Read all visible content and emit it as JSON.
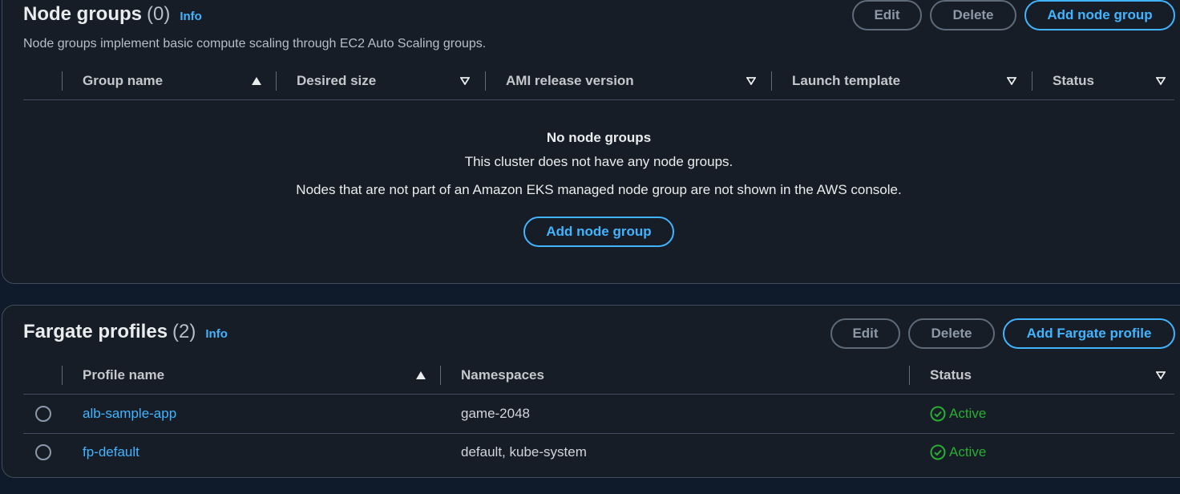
{
  "node_groups": {
    "title": "Node groups",
    "count": "(0)",
    "info": "Info",
    "description": "Node groups implement basic compute scaling through EC2 Auto Scaling groups.",
    "buttons": {
      "edit": "Edit",
      "delete": "Delete",
      "add": "Add node group"
    },
    "columns": [
      "Group name",
      "Desired size",
      "AMI release version",
      "Launch template",
      "Status"
    ],
    "empty": {
      "title": "No node groups",
      "line1": "This cluster does not have any node groups.",
      "line2": "Nodes that are not part of an Amazon EKS managed node group are not shown in the AWS console.",
      "button": "Add node group"
    }
  },
  "fargate_profiles": {
    "title": "Fargate profiles",
    "count": "(2)",
    "info": "Info",
    "buttons": {
      "edit": "Edit",
      "delete": "Delete",
      "add": "Add Fargate profile"
    },
    "columns": [
      "Profile name",
      "Namespaces",
      "Status"
    ],
    "rows": [
      {
        "name": "alb-sample-app",
        "namespaces": "game-2048",
        "status": "Active"
      },
      {
        "name": "fp-default",
        "namespaces": "default, kube-system",
        "status": "Active"
      }
    ]
  },
  "colors": {
    "accent": "#42b4ff",
    "success": "#29ad32",
    "background": "#161d26"
  },
  "icons": {
    "sort_asc": "caret-up-filled",
    "sort_none": "caret-down-outline",
    "status_ok": "check-circle-icon"
  }
}
